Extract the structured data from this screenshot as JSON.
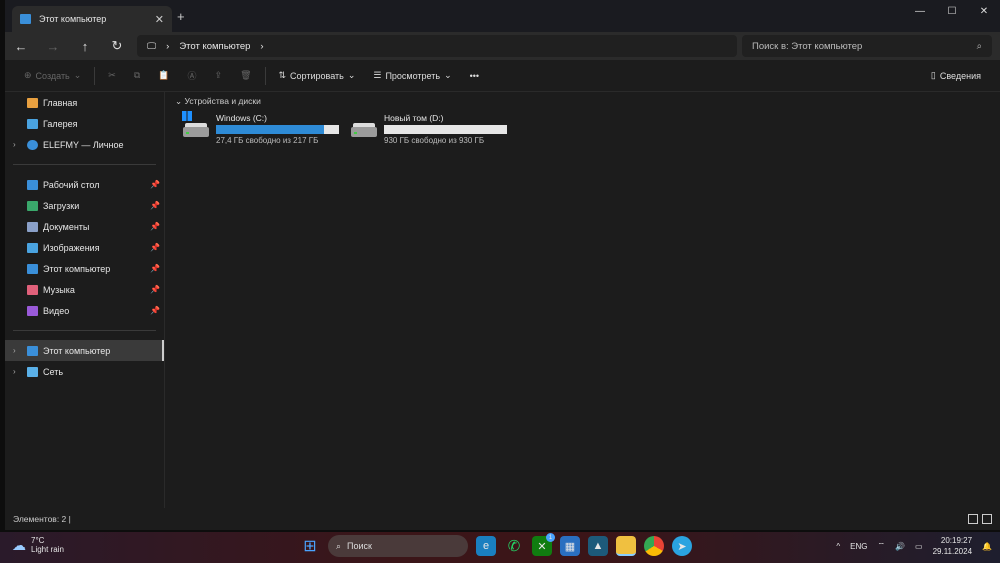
{
  "window": {
    "tab_title": "Этот компьютер",
    "address": "Этот компьютер",
    "search_placeholder": "Поиск в: Этот компьютер"
  },
  "toolbar": {
    "create": "Создать",
    "sort": "Сортировать",
    "view": "Просмотреть",
    "more": "•••",
    "details": "Сведения"
  },
  "sidebar": {
    "top": [
      {
        "label": "Главная"
      },
      {
        "label": "Галерея"
      },
      {
        "label": "ELEFMY — Личное"
      }
    ],
    "pinned": [
      {
        "label": "Рабочий стол",
        "color": "#3a8fd9"
      },
      {
        "label": "Загрузки",
        "color": "#3aa86b"
      },
      {
        "label": "Документы",
        "color": "#8aa0c8"
      },
      {
        "label": "Изображения",
        "color": "#4aa3e0"
      },
      {
        "label": "Этот компьютер",
        "color": "#3a8fd9"
      },
      {
        "label": "Музыка",
        "color": "#e0607a"
      },
      {
        "label": "Видео",
        "color": "#9a5ad9"
      }
    ],
    "bottom": [
      {
        "label": "Этот компьютер"
      },
      {
        "label": "Сеть"
      }
    ]
  },
  "main": {
    "group": "Устройства и диски",
    "drives": [
      {
        "name": "Windows (C:)",
        "free": "27,4 ГБ свободно из 217 ГБ",
        "used_fraction": 0.874
      },
      {
        "name": "Новый том (D:)",
        "free": "930 ГБ свободно из 930 ГБ",
        "used_fraction": 0.0
      }
    ]
  },
  "status": {
    "items": "Элементов: 2"
  },
  "taskbar": {
    "temp": "7°C",
    "weather": "Light rain",
    "search": "Поиск",
    "lang": "ENG",
    "time": "20:19:27",
    "date": "29.11.2024",
    "xbox_badge": "1"
  }
}
